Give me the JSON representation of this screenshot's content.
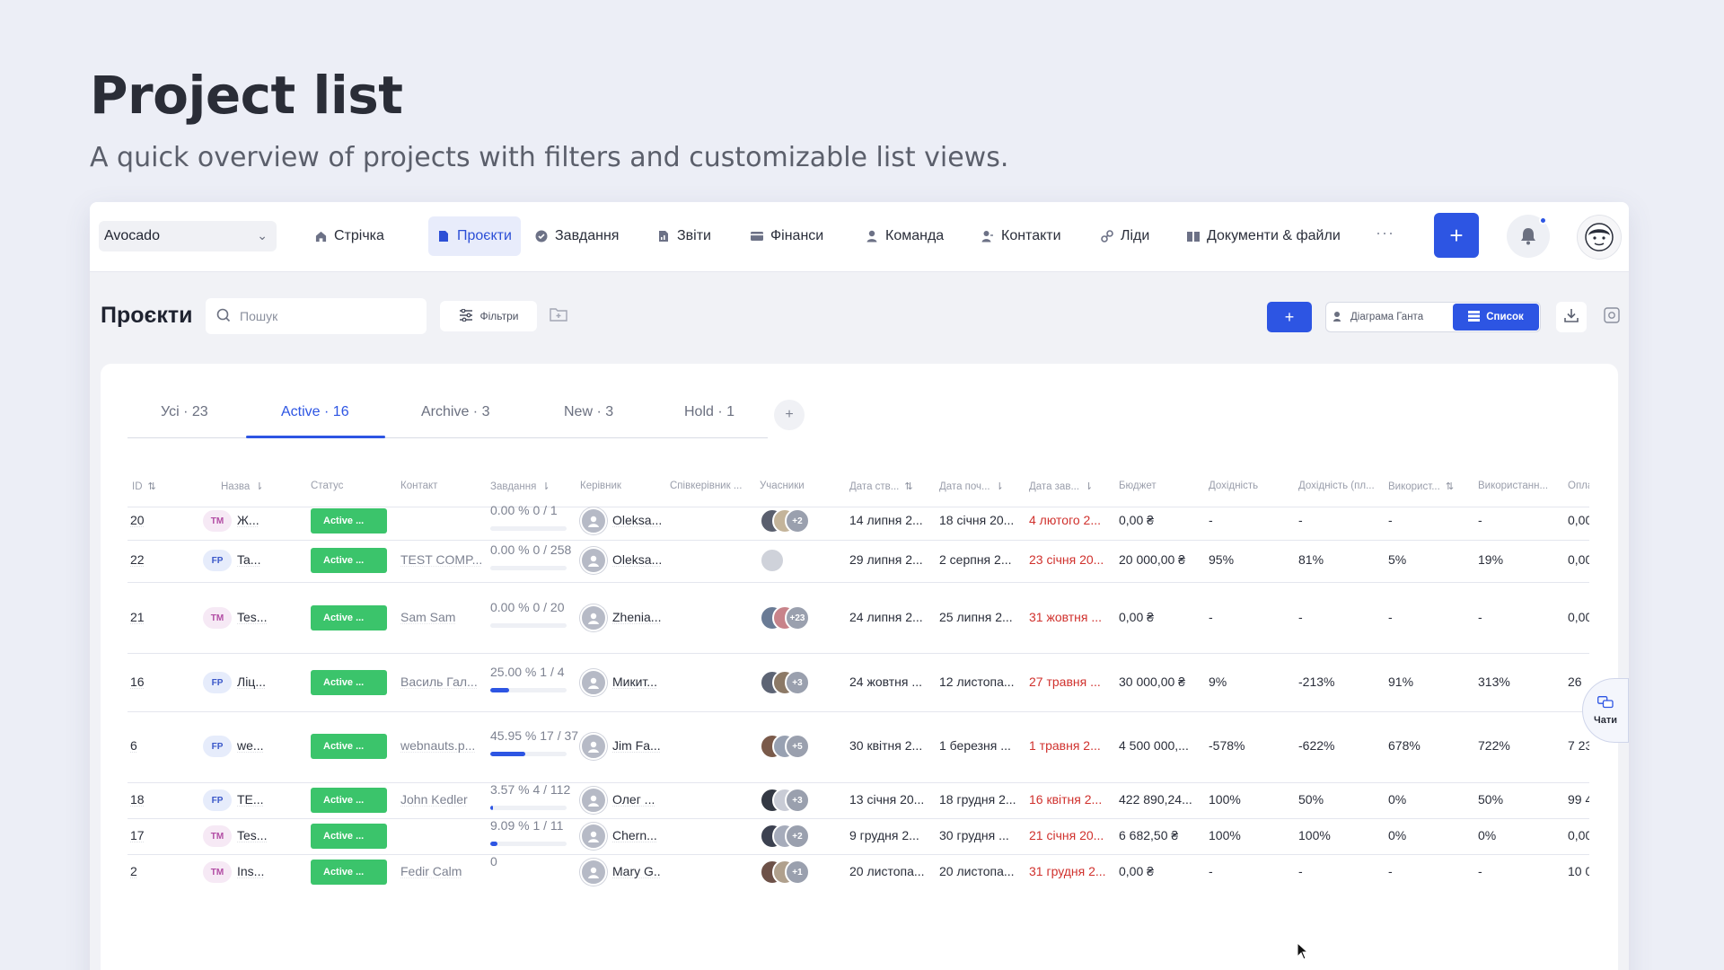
{
  "hero": {
    "title": "Project list",
    "subtitle": "A quick overview of projects with filters and customizable list views."
  },
  "topnav": {
    "workspace": "Avocado",
    "items": [
      {
        "label": "Стрічка",
        "icon": "home-icon"
      },
      {
        "label": "Проєкти",
        "icon": "document-icon",
        "active": true
      },
      {
        "label": "Завдання",
        "icon": "check-circle-icon"
      },
      {
        "label": "Звіти",
        "icon": "report-icon"
      },
      {
        "label": "Фінанси",
        "icon": "finance-icon"
      },
      {
        "label": "Команда",
        "icon": "user-icon"
      },
      {
        "label": "Контакти",
        "icon": "contacts-icon"
      },
      {
        "label": "Ліди",
        "icon": "leads-icon"
      },
      {
        "label": "Документи & файли",
        "icon": "book-icon"
      }
    ],
    "more": "···",
    "add": "+"
  },
  "toolbar": {
    "title": "Проєкти",
    "search_placeholder": "Пошук",
    "filters": "Фільтри",
    "add": "+",
    "gantt": "Діаграма Ганта",
    "list": "Список"
  },
  "tabs": [
    {
      "label": "Усі · 23"
    },
    {
      "label": "Active · 16",
      "active": true
    },
    {
      "label": "Archive · 3"
    },
    {
      "label": "New · 3"
    },
    {
      "label": "Hold · 1"
    }
  ],
  "tab_add": "+",
  "columns": [
    "ID",
    "Назва",
    "Статус",
    "Контакт",
    "Завдання",
    "Керівник",
    "Співкерівник ...",
    "Учасники",
    "Дата ств...",
    "Дата поч...",
    "Дата зав...",
    "Бюджет",
    "Дохідність",
    "Дохідність (пл...",
    "Використ...",
    "Використанн...",
    "Опла"
  ],
  "rows": [
    {
      "id": "20",
      "type": "TM",
      "name": "Ж...",
      "status": "Active ...",
      "contact": "",
      "task": "0.00 %   0 / 1",
      "progress": 0,
      "manager": "Oleksa...",
      "members_more": "+2",
      "created": "14 липня 2...",
      "start": "18 січня 20...",
      "end": "4 лютого 2...",
      "budget": "0,00 ₴",
      "profit": "-",
      "profit_plan": "-",
      "used": "-",
      "used_plan": "-",
      "paid": "0,00"
    },
    {
      "id": "22",
      "type": "FP",
      "name": "Ta...",
      "status": "Active ...",
      "contact": "TEST COMP...",
      "task": "0.00 % 0 / 258",
      "progress": 0,
      "manager": "Oleksa...",
      "members_more": "",
      "created": "29 липня 2...",
      "start": "2 серпня 2...",
      "end": "23 січня 20...",
      "budget": "20 000,00 ₴",
      "profit": "95%",
      "profit_plan": "81%",
      "used": "5%",
      "used_plan": "19%",
      "paid": "0,00"
    },
    {
      "id": "21",
      "type": "TM",
      "name": "Tes...",
      "status": "Active ...",
      "contact": "Sam Sam",
      "task": "0.00 % 0 / 20",
      "progress": 0,
      "manager": "Zhenia...",
      "members_more": "+23",
      "created": "24 липня 2...",
      "start": "25 липня 2...",
      "end": "31 жовтня ...",
      "budget": "0,00 ₴",
      "profit": "-",
      "profit_plan": "-",
      "used": "-",
      "used_plan": "-",
      "paid": "0,00"
    },
    {
      "id": "16",
      "type": "FP",
      "name": "Ліц...",
      "status": "Active ...",
      "contact": "Василь Гал...",
      "task": "25.00 % 1 / 4",
      "progress": 0.25,
      "manager": "Микит...",
      "members_more": "+3",
      "created": "24 жовтня ...",
      "start": "12 листопа...",
      "end": "27 травня ...",
      "budget": "30 000,00 ₴",
      "profit": "9%",
      "profit_plan": "-213%",
      "used": "91%",
      "used_plan": "313%",
      "paid": "26"
    },
    {
      "id": "6",
      "type": "FP",
      "name": "we...",
      "status": "Active ...",
      "contact": "webnauts.p...",
      "task": "45.95 % 17 / 37",
      "progress": 0.4595,
      "manager": "Jim Fa...",
      "members_more": "+5",
      "created": "30 квітня 2...",
      "start": "1 березня ...",
      "end": "1 травня 2...",
      "budget": "4 500 000,...",
      "profit": "-578%",
      "profit_plan": "-622%",
      "used": "678%",
      "used_plan": "722%",
      "paid": "7 23"
    },
    {
      "id": "18",
      "type": "FP",
      "name": "TE...",
      "status": "Active ...",
      "contact": "John Kedler",
      "task": "3.57 % 4 / 112",
      "progress": 0.0357,
      "manager": "Олег ...",
      "members_more": "+3",
      "created": "13 січня 20...",
      "start": "18 грудня 2...",
      "end": "16 квітня 2...",
      "budget": "422 890,24...",
      "profit": "100%",
      "profit_plan": "50%",
      "used": "0%",
      "used_plan": "50%",
      "paid": "99 4"
    },
    {
      "id": "17",
      "type": "TM",
      "name": "Tes...",
      "status": "Active ...",
      "contact": "",
      "task": "9.09 %    1 / 11",
      "progress": 0.0909,
      "manager": "Chern...",
      "members_more": "+2",
      "created": "9 грудня 2...",
      "start": "30 грудня ...",
      "end": "21 січня 20...",
      "budget": "6 682,50 ₴",
      "profit": "100%",
      "profit_plan": "100%",
      "used": "0%",
      "used_plan": "0%",
      "paid": "0,00"
    },
    {
      "id": "2",
      "type": "TM",
      "name": "Ins...",
      "status": "Active ...",
      "contact": "Fedir Calm",
      "task": "0",
      "progress": null,
      "manager": "Mary G...",
      "members_more": "+1",
      "created": "20 листопа...",
      "start": "20 листопа...",
      "end": "31 грудня 2...",
      "budget": "0,00 ₴",
      "profit": "-",
      "profit_plan": "-",
      "used": "-",
      "used_plan": "-",
      "paid": "10 0"
    }
  ],
  "chat": "Чати",
  "colors": {
    "accent": "#2d55e3",
    "status_active": "#3bc46b",
    "overdue": "#d0312d"
  }
}
